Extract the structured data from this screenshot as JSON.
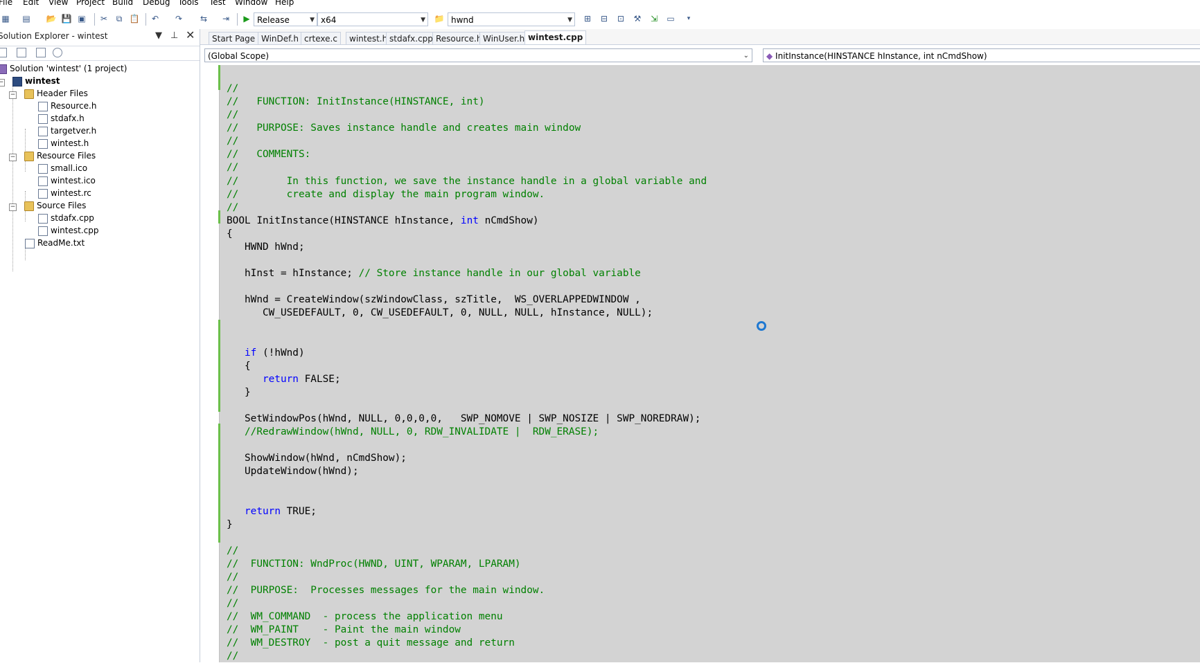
{
  "menu": [
    "File",
    "Edit",
    "View",
    "Project",
    "Build",
    "Debug",
    "Tools",
    "Test",
    "Window",
    "Help"
  ],
  "toolbar": {
    "config": "Release",
    "platform": "x64",
    "find": "hwnd"
  },
  "solution_explorer": {
    "title": "Solution Explorer - wintest",
    "solution": "Solution 'wintest' (1 project)",
    "project": "wintest",
    "folders": {
      "header": "Header Files",
      "resource": "Resource Files",
      "source": "Source Files"
    },
    "header_files": [
      "Resource.h",
      "stdafx.h",
      "targetver.h",
      "wintest.h"
    ],
    "resource_files": [
      "small.ico",
      "wintest.ico",
      "wintest.rc"
    ],
    "source_files": [
      "stdafx.cpp",
      "wintest.cpp"
    ],
    "readme": "ReadMe.txt"
  },
  "tabs": [
    "Start Page",
    "WinDef.h",
    "crtexe.c",
    "wintest.h",
    "stdafx.cpp",
    "Resource.h",
    "WinUser.h",
    "wintest.cpp"
  ],
  "active_tab": "wintest.cpp",
  "scope": {
    "left": "(Global Scope)",
    "right": "InitInstance(HINSTANCE hInstance, int nCmdShow)"
  },
  "code": [
    "//",
    "//   FUNCTION: InitInstance(HINSTANCE, int)",
    "//",
    "//   PURPOSE: Saves instance handle and creates main window",
    "//",
    "//   COMMENTS:",
    "//",
    "//        In this function, we save the instance handle in a global variable and",
    "//        create and display the main program window.",
    "//",
    "BOOL InitInstance(HINSTANCE hInstance, int nCmdShow)",
    "{",
    "   HWND hWnd;",
    "",
    "   hInst = hInstance; // Store instance handle in our global variable",
    "",
    "   hWnd = CreateWindow(szWindowClass, szTitle,  WS_OVERLAPPEDWINDOW ,",
    "      CW_USEDEFAULT, 0, CW_USEDEFAULT, 0, NULL, NULL, hInstance, NULL);",
    "",
    "",
    "   if (!hWnd)",
    "   {",
    "      return FALSE;",
    "   }",
    "",
    "   SetWindowPos(hWnd, NULL, 0,0,0,0,   SWP_NOMOVE | SWP_NOSIZE | SWP_NOREDRAW);",
    "   //RedrawWindow(hWnd, NULL, 0, RDW_INVALIDATE |  RDW_ERASE);",
    "",
    "   ShowWindow(hWnd, nCmdShow);",
    "   UpdateWindow(hWnd);",
    "",
    "",
    "   return TRUE;",
    "}",
    "",
    "//",
    "//  FUNCTION: WndProc(HWND, UINT, WPARAM, LPARAM)",
    "//",
    "//  PURPOSE:  Processes messages for the main window.",
    "//",
    "//  WM_COMMAND  - process the application menu",
    "//  WM_PAINT    - Paint the main window",
    "//  WM_DESTROY  - post a quit message and return",
    "//"
  ]
}
